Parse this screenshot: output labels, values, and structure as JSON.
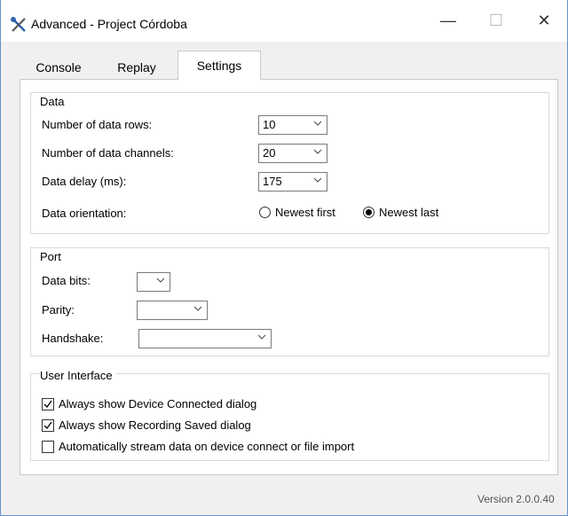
{
  "window": {
    "title": "Advanced - Project Córdoba",
    "controls": {
      "minimize": "—",
      "maximize": "☐",
      "close": "✕"
    }
  },
  "tabs": [
    {
      "label": "Console",
      "selected": false
    },
    {
      "label": "Replay",
      "selected": false
    },
    {
      "label": "Settings",
      "selected": true
    }
  ],
  "data_group": {
    "title": "Data",
    "rows_label": "Number of data rows:",
    "rows_value": "10",
    "channels_label": "Number of data channels:",
    "channels_value": "20",
    "delay_label": "Data delay (ms):",
    "delay_value": "175",
    "orientation_label": "Data orientation:",
    "orientation_options": [
      {
        "label": "Newest first",
        "checked": false
      },
      {
        "label": "Newest last",
        "checked": true
      }
    ]
  },
  "port_group": {
    "title": "Port",
    "data_bits_label": "Data bits:",
    "data_bits_value": "",
    "parity_label": "Parity:",
    "parity_value": "",
    "handshake_label": "Handshake:",
    "handshake_value": ""
  },
  "ui_group": {
    "title": "User Interface",
    "checkboxes": [
      {
        "label": "Always show Device Connected dialog",
        "checked": true
      },
      {
        "label": "Always show Recording Saved dialog",
        "checked": true
      },
      {
        "label": "Automatically stream data on device connect or file import",
        "checked": false
      }
    ]
  },
  "version": "Version 2.0.0.40",
  "colors": {
    "window_border": "#6a8fc8",
    "background": "#f0f0f0",
    "panel": "#ffffff"
  },
  "icons": {
    "app": "tools-icon",
    "dropdown": "chevron-down-icon"
  }
}
